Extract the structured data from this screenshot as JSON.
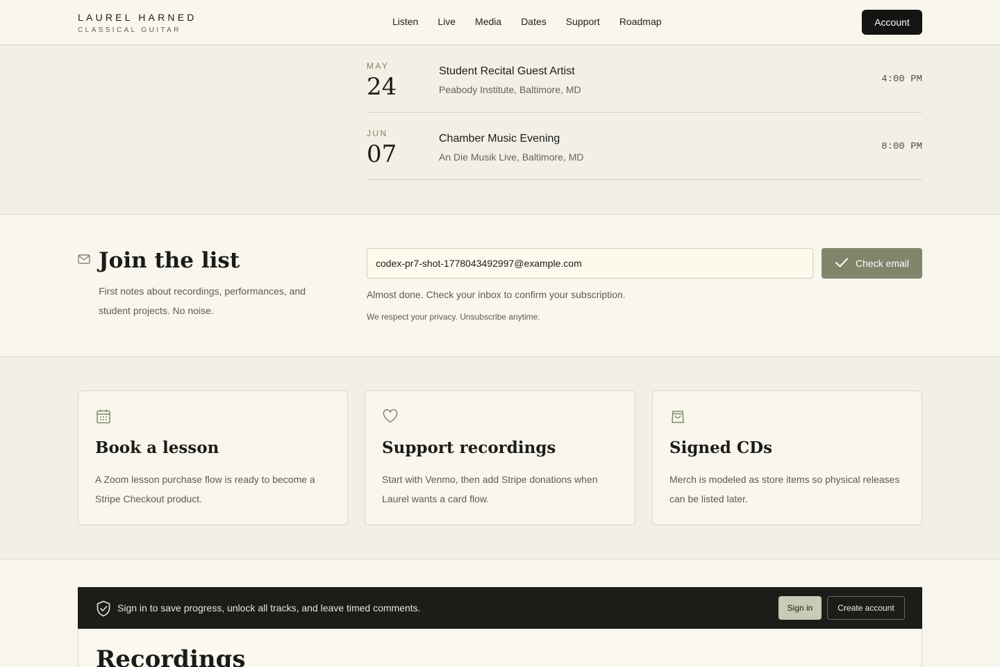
{
  "header": {
    "brand_name": "LAUREL HARNED",
    "brand_sub": "CLASSICAL GUITAR",
    "nav": [
      "Listen",
      "Live",
      "Media",
      "Dates",
      "Support",
      "Roadmap"
    ],
    "account_label": "Account"
  },
  "events": [
    {
      "month": "MAY",
      "day": "24",
      "title": "Student Recital Guest Artist",
      "venue": "Peabody Institute, Baltimore, MD",
      "time": "4:00 PM"
    },
    {
      "month": "JUN",
      "day": "07",
      "title": "Chamber Music Evening",
      "venue": "An Die Musik Live, Baltimore, MD",
      "time": "8:00 PM"
    }
  ],
  "join": {
    "title": "Join the list",
    "description": "First notes about recordings, performances, and student projects. No noise.",
    "email_value": "codex-pr7-shot-1778043492997@example.com",
    "button_label": "Check email",
    "status": "Almost done. Check your inbox to confirm your subscription.",
    "privacy": "We respect your privacy. Unsubscribe anytime."
  },
  "cards": [
    {
      "icon": "calendar-icon",
      "title": "Book a lesson",
      "description": "A Zoom lesson purchase flow is ready to become a Stripe Checkout product."
    },
    {
      "icon": "heart-icon",
      "title": "Support recordings",
      "description": "Start with Venmo, then add Stripe donations when Laurel wants a card flow."
    },
    {
      "icon": "shopping-bag-icon",
      "title": "Signed CDs",
      "description": "Merch is modeled as store items so physical releases can be listed later."
    }
  ],
  "signin_bar": {
    "text": "Sign in to save progress, unlock all tracks, and leave timed comments.",
    "signin_label": "Sign in",
    "create_label": "Create account"
  },
  "recordings": {
    "title": "Recordings"
  },
  "colors": {
    "accent": "#7f866a",
    "dark": "#141512",
    "background": "#f2efe7"
  }
}
